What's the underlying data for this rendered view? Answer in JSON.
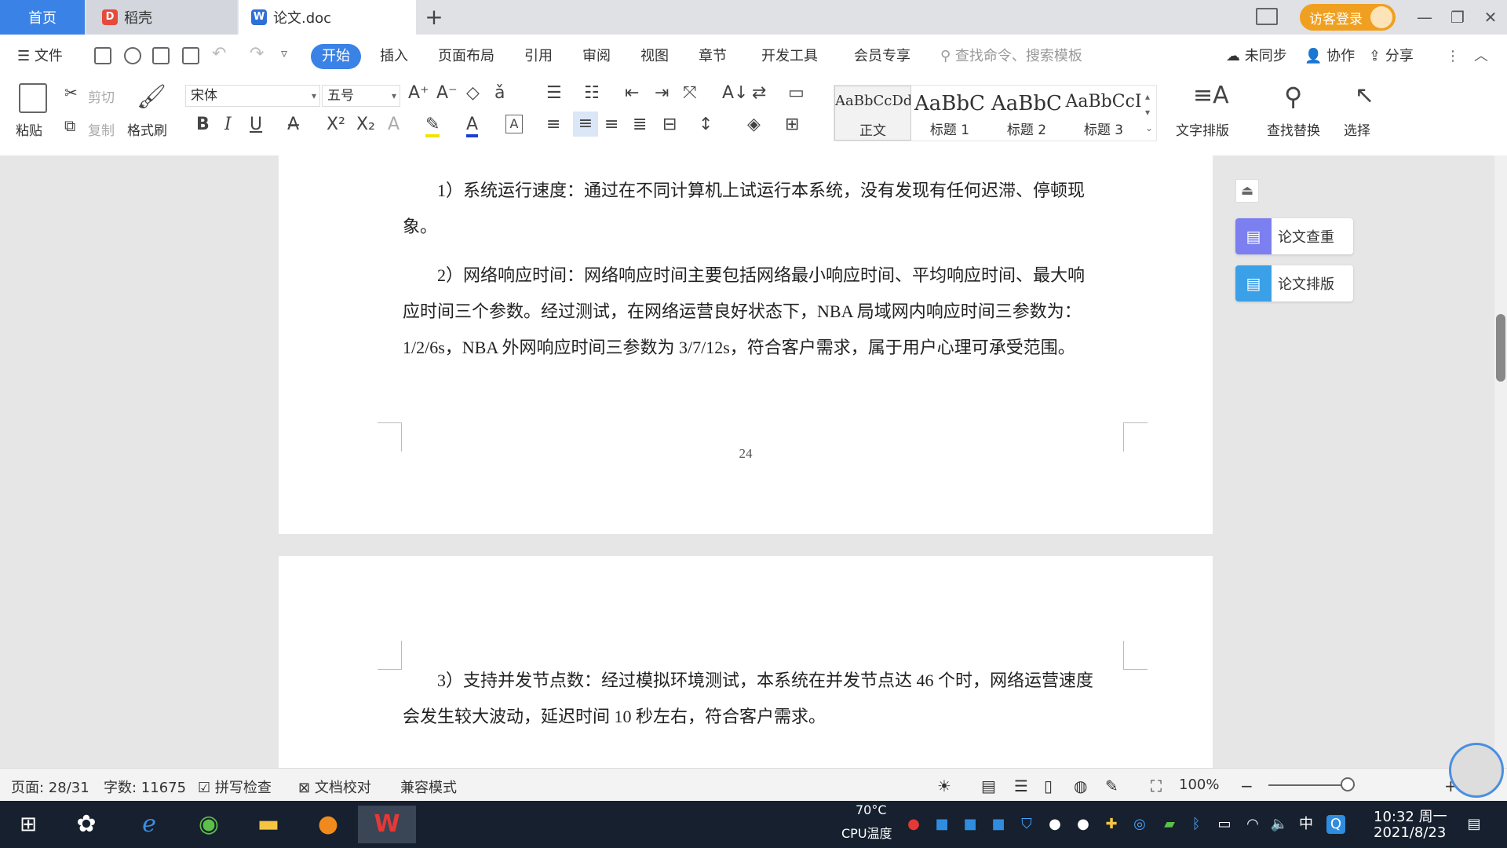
{
  "tabs": {
    "home": "首页",
    "daoke": "稻壳",
    "doc": "论文.doc",
    "add": "+"
  },
  "titlebar": {
    "login": "访客登录",
    "minimize": "—",
    "restore": "❐",
    "close": "✕"
  },
  "menubar": {
    "file": "文件",
    "items": [
      "开始",
      "插入",
      "页面布局",
      "引用",
      "审阅",
      "视图",
      "章节",
      "开发工具",
      "会员专享"
    ],
    "search_placeholder": "查找命令、搜索模板",
    "sync": "未同步",
    "collab": "协作",
    "share": "分享"
  },
  "ribbon": {
    "paste": "粘贴",
    "cut": "剪切",
    "copy": "复制",
    "format_painter": "格式刷",
    "font_name": "宋体",
    "font_size": "五号",
    "styles": [
      {
        "sample": "AaBbCcDd",
        "name": "正文"
      },
      {
        "sample": "AaBbC",
        "name": "标题 1"
      },
      {
        "sample": "AaBbC",
        "name": "标题 2"
      },
      {
        "sample": "AaBbCcI",
        "name": "标题 3"
      }
    ],
    "text_layout": "文字排版",
    "find_replace": "查找替换",
    "select": "选择"
  },
  "document": {
    "page1": {
      "para1": "1）系统运行速度：通过在不同计算机上试运行本系统，没有发现有任何迟滞、停顿现象。",
      "para2": "2）网络响应时间：网络响应时间主要包括网络最小响应时间、平均响应时间、最大响应时间三个参数。经过测试，在网络运营良好状态下，NBA 局域网内响应时间三参数为：1/2/6s，NBA 外网响应时间三参数为 3/7/12s，符合客户需求，属于用户心理可承受范围。",
      "page_number": "24"
    },
    "page2": {
      "para3": "3）支持并发节点数：经过模拟环境测试，本系统在并发节点达 46 个时，网络运营速度会发生较大波动，延迟时间 10 秒左右，符合客户需求。"
    }
  },
  "side_panel": {
    "check": "论文查重",
    "layout": "论文排版"
  },
  "statusbar": {
    "page": "页面: 28/31",
    "words": "字数: 11675",
    "spellcheck": "拼写检查",
    "proofread": "文档校对",
    "compat": "兼容模式",
    "zoom": "100%"
  },
  "taskbar": {
    "temp": "70°C",
    "temp_label": "CPU温度",
    "ime": "中",
    "time": "10:32 周一",
    "date": "2021/8/23"
  },
  "colors": {
    "accent": "#3b82e6",
    "login": "#f0a020",
    "taskbar": "#16202e"
  }
}
